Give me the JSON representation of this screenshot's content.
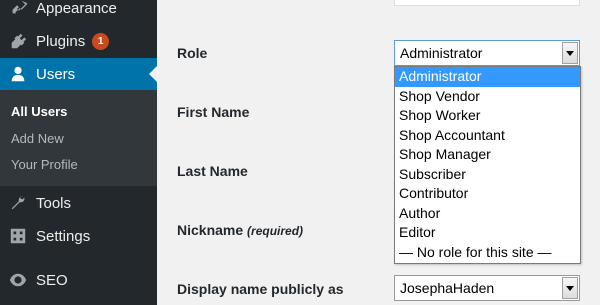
{
  "sidebar": {
    "items": [
      {
        "label": "Appearance",
        "icon": "paintbrush-icon"
      },
      {
        "label": "Plugins",
        "icon": "plugin-icon",
        "badge": "1"
      },
      {
        "label": "Users",
        "icon": "user-icon"
      },
      {
        "label": "Tools",
        "icon": "wrench-icon"
      },
      {
        "label": "Settings",
        "icon": "settings-icon"
      },
      {
        "label": "SEO",
        "icon": "seo-icon"
      }
    ],
    "submenu": [
      "All Users",
      "Add New",
      "Your Profile"
    ],
    "colors": {
      "background": "#23282d",
      "current": "#0073aa",
      "submenu_bg": "#32373c",
      "badge": "#ca4a1f"
    }
  },
  "form": {
    "role_label": "Role",
    "first_name_label": "First Name",
    "last_name_label": "Last Name",
    "nickname_label": "Nickname",
    "nickname_required": "(required)",
    "display_name_label": "Display name publicly as",
    "role_value": "Administrator",
    "display_name_value": "JosephaHaden"
  },
  "role_options": [
    "Administrator",
    "Shop Vendor",
    "Shop Worker",
    "Shop Accountant",
    "Shop Manager",
    "Subscriber",
    "Contributor",
    "Author",
    "Editor",
    "— No role for this site —"
  ],
  "selected_option": "Administrator"
}
